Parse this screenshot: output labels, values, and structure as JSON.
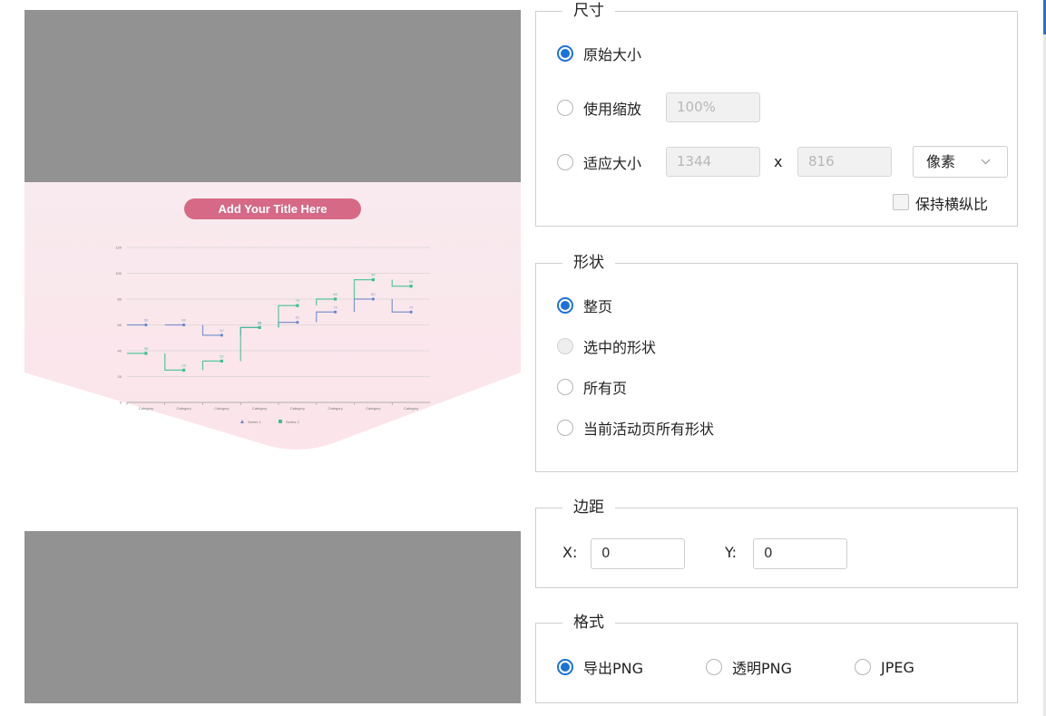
{
  "preview": {
    "chart_title": "Add Your Title Here",
    "chart_data": {
      "type": "line",
      "title": "Add Your Title Here",
      "categories": [
        "Category",
        "Category",
        "Category",
        "Category",
        "Category",
        "Category",
        "Category",
        "Category"
      ],
      "y_ticks": [
        "0",
        "20",
        "40",
        "60",
        "80",
        "100",
        "120"
      ],
      "ylim": [
        0,
        120
      ],
      "grid": true,
      "legend_placement": "bottom",
      "series": [
        {
          "name": "Series 1",
          "color": "#6b86c9",
          "values": [
            60,
            60,
            52,
            58,
            62,
            70,
            80,
            70
          ]
        },
        {
          "name": "Series 2",
          "color": "#3fbf8f",
          "values": [
            38,
            25,
            32,
            58,
            75,
            80,
            95,
            90
          ]
        }
      ]
    }
  },
  "size_group": {
    "legend": "尺寸",
    "original_label": "原始大小",
    "scale_label": "使用缩放",
    "scale_value": "100%",
    "fit_label": "适应大小",
    "width_value": "1344",
    "x_label": "x",
    "height_value": "816",
    "unit_value": "像素",
    "keep_ratio_label": "保持横纵比"
  },
  "shape_group": {
    "legend": "形状",
    "options": [
      "整页",
      "选中的形状",
      "所有页",
      "当前活动页所有形状"
    ]
  },
  "margin_group": {
    "legend": "边距",
    "x_label": "X:",
    "x_value": "0",
    "y_label": "Y:",
    "y_value": "0"
  },
  "format_group": {
    "legend": "格式",
    "options": [
      "导出PNG",
      "透明PNG",
      "JPEG"
    ]
  },
  "colors": {
    "accent": "#1d72d8",
    "preview_bg": "#929292",
    "title_pill": "#d66a86"
  }
}
